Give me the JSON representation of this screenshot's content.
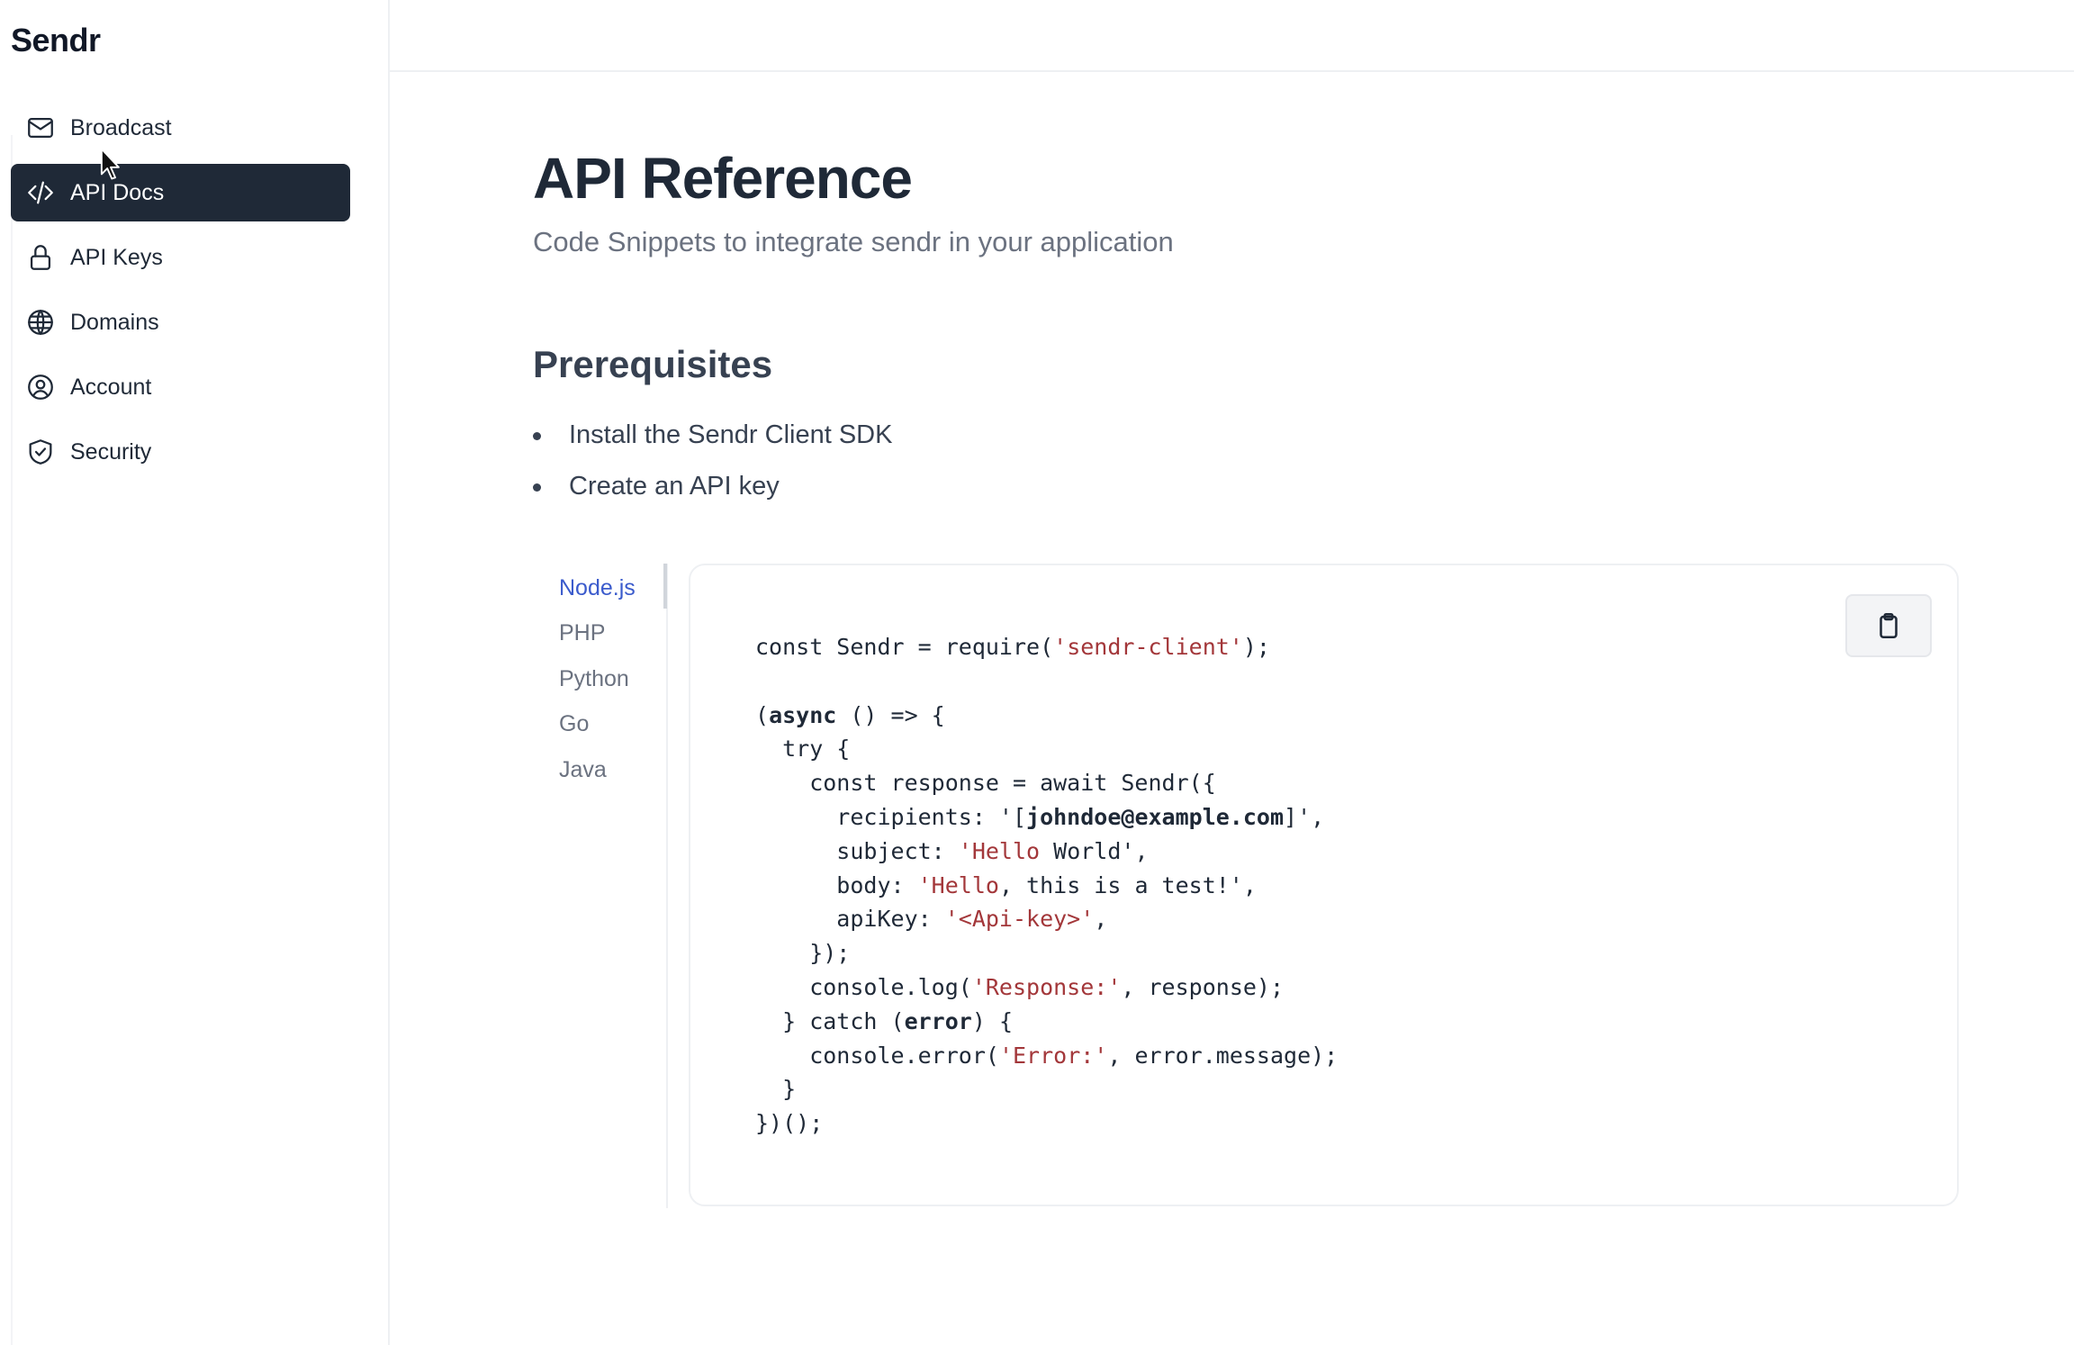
{
  "brand": "Sendr",
  "sidebar": {
    "items": [
      {
        "label": "Broadcast",
        "icon": "mail-icon"
      },
      {
        "label": "API Docs",
        "icon": "code-icon",
        "active": true
      },
      {
        "label": "API Keys",
        "icon": "lock-icon"
      },
      {
        "label": "Domains",
        "icon": "globe-icon"
      },
      {
        "label": "Account",
        "icon": "user-circle-icon"
      },
      {
        "label": "Security",
        "icon": "shield-check-icon"
      }
    ]
  },
  "main": {
    "title": "API Reference",
    "subtitle": "Code Snippets to integrate sendr in your application",
    "prereq_title": "Prerequisites",
    "prereqs": [
      "Install the Sendr Client SDK",
      "Create an API key"
    ]
  },
  "code_section": {
    "tabs": [
      "Node.js",
      "PHP",
      "Python",
      "Go",
      "Java"
    ],
    "active_tab": "Node.js",
    "copy_icon": "clipboard-icon",
    "code": {
      "l1_a": "const Sendr = require(",
      "l1_b": "'sendr-client'",
      "l1_c": ");",
      "l3_a": "(",
      "l3_b": "async",
      "l3_c": " () => {",
      "l4": "  try {",
      "l5": "    const response = await Sendr({",
      "l6_a": "      recipients: '[",
      "l6_b": "johndoe@example.com",
      "l6_c": "]',",
      "l7_a": "      subject: ",
      "l7_b": "'Hello",
      "l7_c": " World',",
      "l8_a": "      body: ",
      "l8_b": "'Hello",
      "l8_c": ", this is a test!',",
      "l9_a": "      apiKey: ",
      "l9_b": "'<Api-key>'",
      "l9_c": ",",
      "l10": "    });",
      "l11_a": "    console.log(",
      "l11_b": "'Response:'",
      "l11_c": ", response);",
      "l12_a": "  } catch (",
      "l12_b": "error",
      "l12_c": ") {",
      "l13_a": "    console.error(",
      "l13_b": "'Error:'",
      "l13_c": ", error.message);",
      "l14": "  }",
      "l15": "})();"
    }
  },
  "colors": {
    "sidebar_active_bg": "#1f2937",
    "active_tab_text": "#3b5bcc",
    "string_color": "#a3373a"
  }
}
